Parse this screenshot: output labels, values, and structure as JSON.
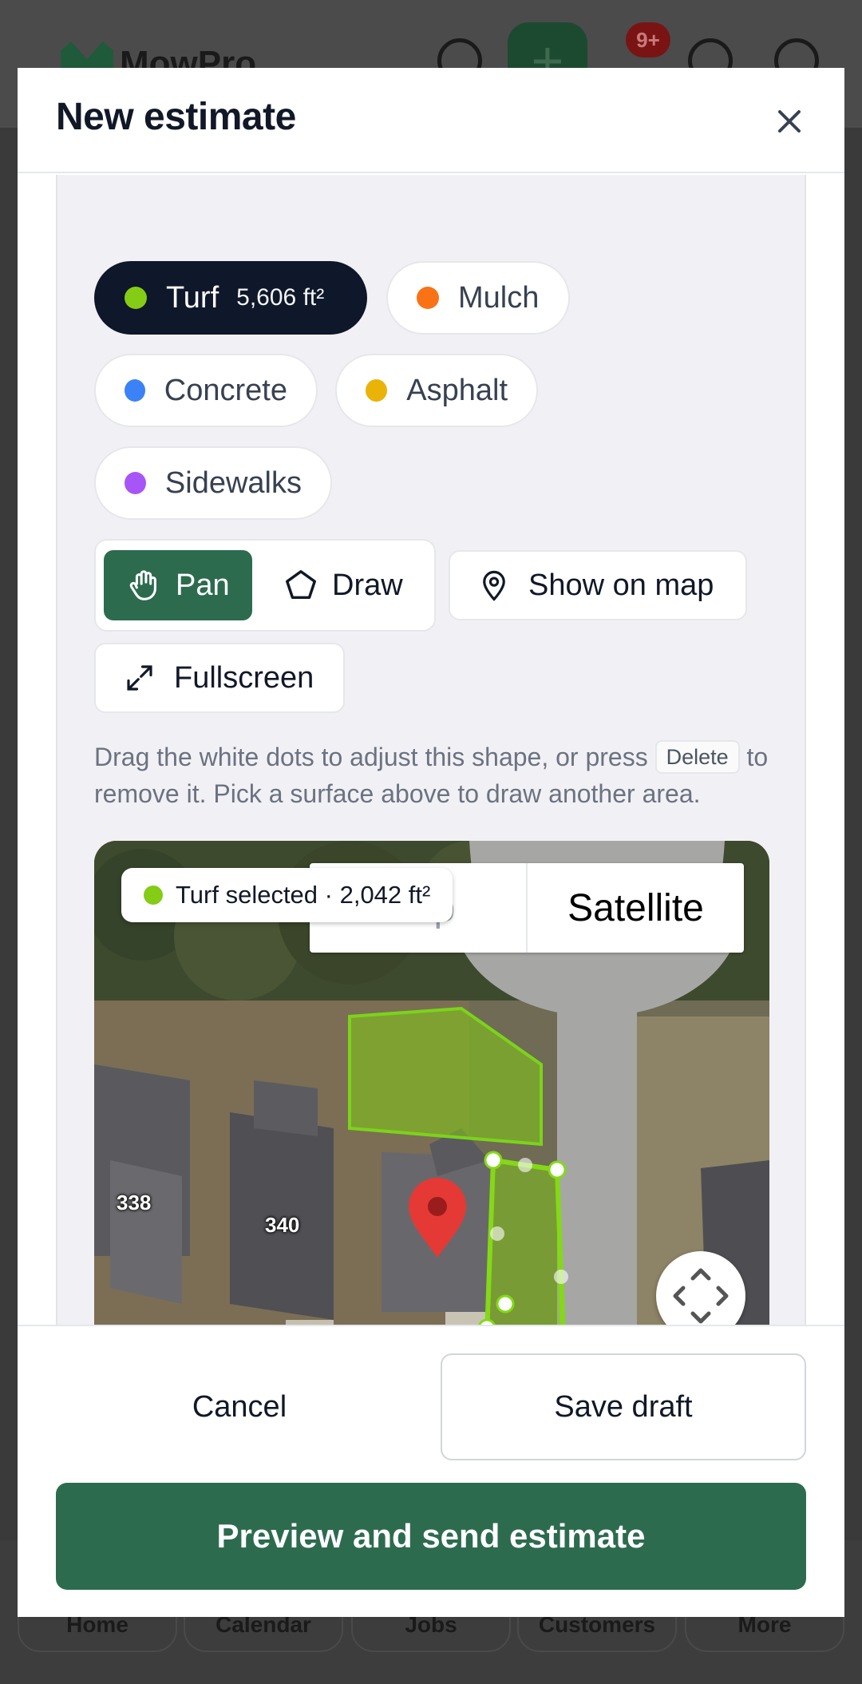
{
  "app": {
    "brand": "MowPro",
    "notification_count": "9+",
    "nav": [
      "Home",
      "Calendar",
      "Jobs",
      "Customers",
      "More"
    ]
  },
  "modal": {
    "title": "New estimate",
    "surfaces": [
      {
        "label": "Turf",
        "area": "5,606 ft²",
        "color": "#84cc16",
        "selected": true
      },
      {
        "label": "Mulch",
        "color": "#f97316",
        "selected": false
      },
      {
        "label": "Concrete",
        "color": "#3b82f6",
        "selected": false
      },
      {
        "label": "Asphalt",
        "color": "#eab308",
        "selected": false
      },
      {
        "label": "Sidewalks",
        "color": "#a855f7",
        "selected": false
      }
    ],
    "tools": {
      "pan": "Pan",
      "draw": "Draw",
      "show_on_map": "Show on map",
      "fullscreen": "Fullscreen",
      "active": "pan"
    },
    "hint": {
      "before": "Drag the white dots to adjust this shape, or press",
      "key": "Delete",
      "after": "to remove it. Pick a surface above to draw another area."
    },
    "map": {
      "selection_badge": "Turf selected · 2,042 ft²",
      "map_type_options": [
        "Map",
        "Satellite"
      ],
      "map_type_selected": "Satellite",
      "house_numbers": [
        "338",
        "340"
      ]
    }
  },
  "footer": {
    "cancel": "Cancel",
    "save_draft": "Save draft",
    "primary": "Preview and send estimate"
  },
  "colors": {
    "accent": "#2d6b4f",
    "active_chip": "#0f172a",
    "turf": "#84cc16"
  }
}
